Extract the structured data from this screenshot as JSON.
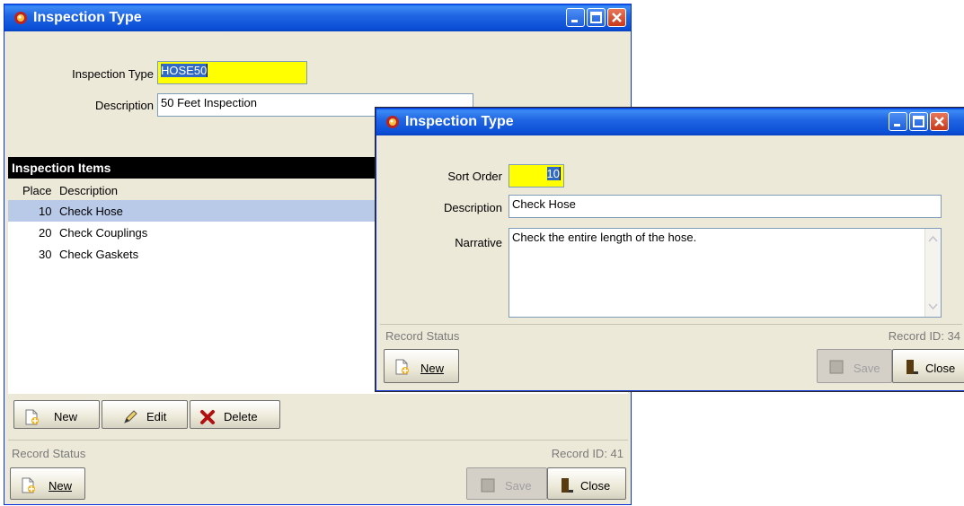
{
  "back_window": {
    "title": "Inspection Type",
    "inspection_type_label": "Inspection Type",
    "inspection_type_value": "HOSE50",
    "description_label": "Description",
    "description_value": "50 Feet Inspection",
    "items_header": "Inspection Items",
    "columns": [
      "Place",
      "Description"
    ],
    "rows": [
      {
        "place": "10",
        "description": "Check Hose"
      },
      {
        "place": "20",
        "description": "Check Couplings"
      },
      {
        "place": "30",
        "description": "Check Gaskets"
      }
    ],
    "item_buttons": {
      "new": "New",
      "edit": "Edit",
      "delete": "Delete"
    },
    "record_status": "Record Status",
    "record_id": "Record ID: 41",
    "new_label": "New",
    "save_label": "Save",
    "close_label": "Close"
  },
  "front_window": {
    "title": "Inspection Type",
    "sort_order_label": "Sort Order",
    "sort_order_value": "10",
    "description_label": "Description",
    "description_value": "Check Hose",
    "narrative_label": "Narrative",
    "narrative_value": "Check the entire length of the hose.",
    "record_status": "Record Status",
    "record_id": "Record ID: 34",
    "new_label": "New",
    "save_label": "Save",
    "close_label": "Close"
  },
  "colors": {
    "titlebar": "#0a4fd6",
    "field_highlight": "#ffff00",
    "selection": "#316ac5",
    "row_selected": "#b9c9e8"
  },
  "icons": [
    "app-icon",
    "minimize-icon",
    "maximize-icon",
    "close-icon",
    "new-doc-icon",
    "edit-pencil-icon",
    "delete-x-icon",
    "save-disk-icon",
    "door-exit-icon"
  ]
}
